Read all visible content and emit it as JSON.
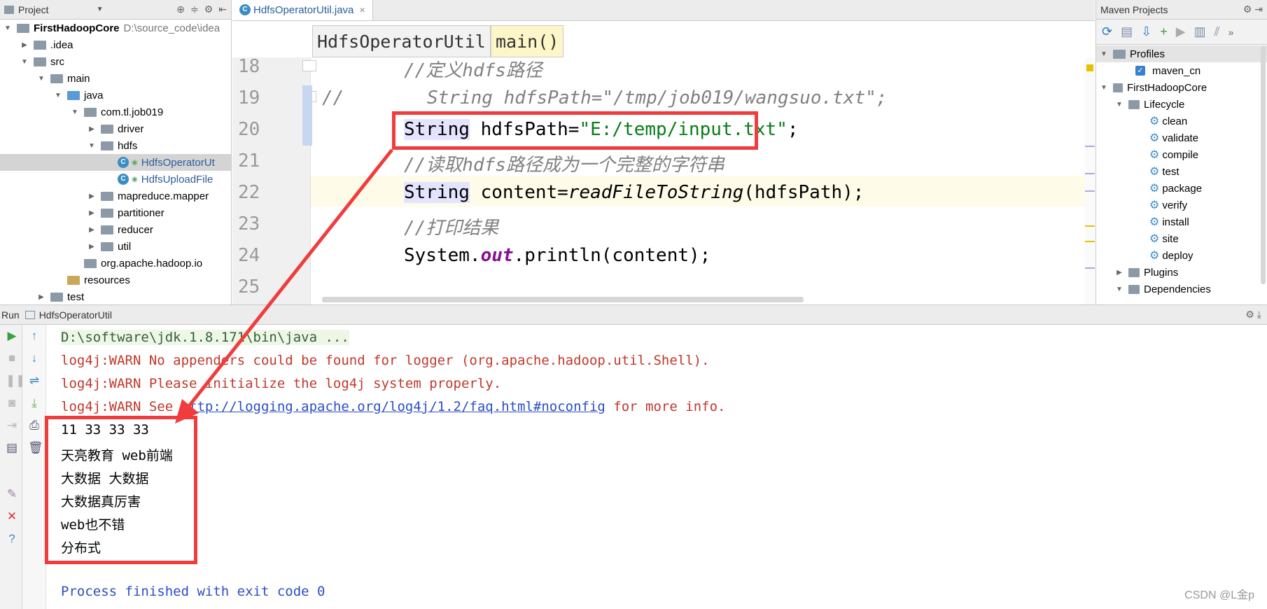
{
  "project": {
    "title": "Project",
    "tree": [
      {
        "label": "FirstHadoopCore",
        "extra": "D:\\source_code\\idea",
        "depth": 0,
        "type": "module",
        "open": true
      },
      {
        "label": ".idea",
        "depth": 1,
        "type": "folder",
        "open": false
      },
      {
        "label": "src",
        "depth": 1,
        "type": "folder",
        "open": true
      },
      {
        "label": "main",
        "depth": 2,
        "type": "folder",
        "open": true
      },
      {
        "label": "java",
        "depth": 3,
        "type": "folder-blue",
        "open": true
      },
      {
        "label": "com.tl.job019",
        "depth": 4,
        "type": "package",
        "open": true
      },
      {
        "label": "driver",
        "depth": 5,
        "type": "package",
        "open": false
      },
      {
        "label": "hdfs",
        "depth": 5,
        "type": "package",
        "open": true
      },
      {
        "label": "HdfsOperatorUt",
        "depth": 6,
        "type": "class",
        "selected": true
      },
      {
        "label": "HdfsUploadFile",
        "depth": 6,
        "type": "class"
      },
      {
        "label": "mapreduce.mapper",
        "depth": 5,
        "type": "package",
        "open": false
      },
      {
        "label": "partitioner",
        "depth": 5,
        "type": "package",
        "open": false
      },
      {
        "label": "reducer",
        "depth": 5,
        "type": "package",
        "open": false
      },
      {
        "label": "util",
        "depth": 5,
        "type": "package",
        "open": false
      },
      {
        "label": "org.apache.hadoop.io",
        "depth": 4,
        "type": "package"
      },
      {
        "label": "resources",
        "depth": 3,
        "type": "folder-res"
      },
      {
        "label": "test",
        "depth": 2,
        "type": "folder",
        "open": false
      }
    ]
  },
  "editor": {
    "tab_label": "HdfsOperatorUtil.java",
    "breadcrumb": [
      "HdfsOperatorUtil",
      "main()"
    ],
    "lines": [
      {
        "num": "18"
      },
      {
        "num": "19"
      },
      {
        "num": "20"
      },
      {
        "num": "21"
      },
      {
        "num": "22"
      },
      {
        "num": "23"
      },
      {
        "num": "24"
      },
      {
        "num": "25"
      }
    ],
    "code": {
      "l18": "//定义hdfs路径",
      "l19_prefix": "//",
      "l19": "String hdfsPath=\"/tmp/job019/wangsuo.txt\";",
      "l20_type": "String",
      "l20_var": " hdfsPath=",
      "l20_str": "\"E:/temp/input.txt\"",
      "l20_end": ";",
      "l21": "//读取hdfs路径成为一个完整的字符串",
      "l22_type": "String",
      "l22_a": " content=",
      "l22_m": "readFileToString",
      "l22_b": "(hdfsPath);",
      "l23": "//打印结果",
      "l24_a": "System.",
      "l24_out": "out",
      "l24_b": ".println(content);"
    }
  },
  "maven": {
    "title": "Maven Projects",
    "profiles_label": "Profiles",
    "profile": "maven_cn",
    "project": "FirstHadoopCore",
    "lifecycle_label": "Lifecycle",
    "lifecycle": [
      "clean",
      "validate",
      "compile",
      "test",
      "package",
      "verify",
      "install",
      "site",
      "deploy"
    ],
    "plugins_label": "Plugins",
    "dependencies_label": "Dependencies"
  },
  "run": {
    "label": "Run",
    "config": "HdfsOperatorUtil",
    "output": [
      {
        "text": "D:\\software\\jdk.1.8.171\\bin\\java ...",
        "kind": "cmd"
      },
      {
        "text": "log4j:WARN No appenders could be found for logger (org.apache.hadoop.util.Shell).",
        "kind": "warn"
      },
      {
        "text": "log4j:WARN Please initialize the log4j system properly.",
        "kind": "warn"
      },
      {
        "text_a": "log4j:WARN See ",
        "link": "http://logging.apache.org/log4j/1.2/faq.html#noconfig",
        "text_b": " for more info.",
        "kind": "warn-link"
      },
      {
        "text": "11 33 33 33",
        "kind": "plain"
      },
      {
        "text": "天亮教育 web前端",
        "kind": "plain"
      },
      {
        "text": "大数据 大数据",
        "kind": "plain"
      },
      {
        "text": "大数据真厉害",
        "kind": "plain"
      },
      {
        "text": "web也不错",
        "kind": "plain"
      },
      {
        "text": "分布式",
        "kind": "plain"
      },
      {
        "text": "",
        "kind": "plain"
      },
      {
        "text": "Process finished with exit code 0",
        "kind": "exit"
      }
    ]
  },
  "watermark": "CSDN @L金p",
  "colors": {
    "annotation_red": "#f03c3c",
    "accent": "#2a7abf"
  }
}
